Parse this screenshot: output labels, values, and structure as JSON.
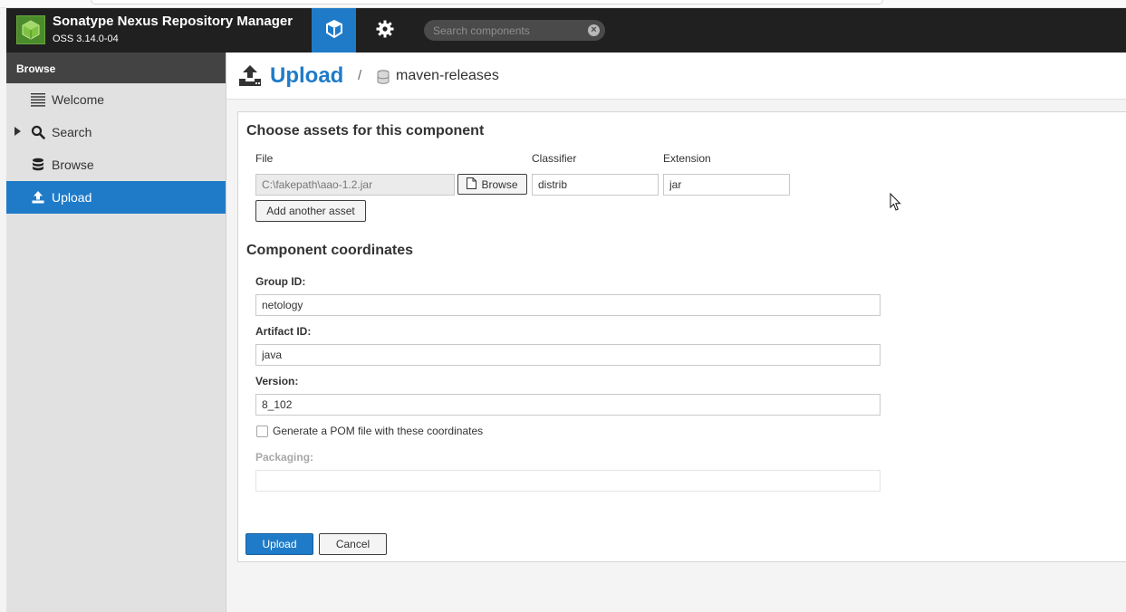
{
  "app": {
    "title": "Sonatype Nexus Repository Manager",
    "version": "OSS 3.14.0-04"
  },
  "header": {
    "search_placeholder": "Search components",
    "icons": [
      "box-icon",
      "gear-icon",
      "clear-icon"
    ]
  },
  "sidebar": {
    "header": "Browse",
    "items": [
      {
        "label": "Welcome",
        "icon": "list-icon",
        "selected": false
      },
      {
        "label": "Search",
        "icon": "search-icon",
        "selected": false
      },
      {
        "label": "Browse",
        "icon": "database-icon",
        "selected": false
      },
      {
        "label": "Upload",
        "icon": "upload-icon",
        "selected": true
      }
    ]
  },
  "page": {
    "title": "Upload",
    "separator": "/",
    "repository": "maven-releases"
  },
  "assets": {
    "title": "Choose assets for this component",
    "col_file": "File",
    "col_classifier": "Classifier",
    "col_extension": "Extension",
    "file_value": "C:\\fakepath\\aao-1.2.jar",
    "browse_label": "Browse",
    "classifier_value": "distrib",
    "extension_value": "jar",
    "add_asset_label": "Add another asset"
  },
  "coordinates": {
    "title": "Component coordinates",
    "group_label": "Group ID:",
    "group_value": "netology",
    "artifact_label": "Artifact ID:",
    "artifact_value": "java",
    "version_label": "Version:",
    "version_value": "8_102",
    "pom_label": "Generate a POM file with these coordinates",
    "pom_checked": false,
    "packaging_label": "Packaging:",
    "packaging_value": ""
  },
  "actions": {
    "upload_label": "Upload",
    "cancel_label": "Cancel"
  },
  "colors": {
    "accent": "#1f7bc8",
    "header_bg": "#202020",
    "sidebar_bg": "#e1e1e1"
  }
}
